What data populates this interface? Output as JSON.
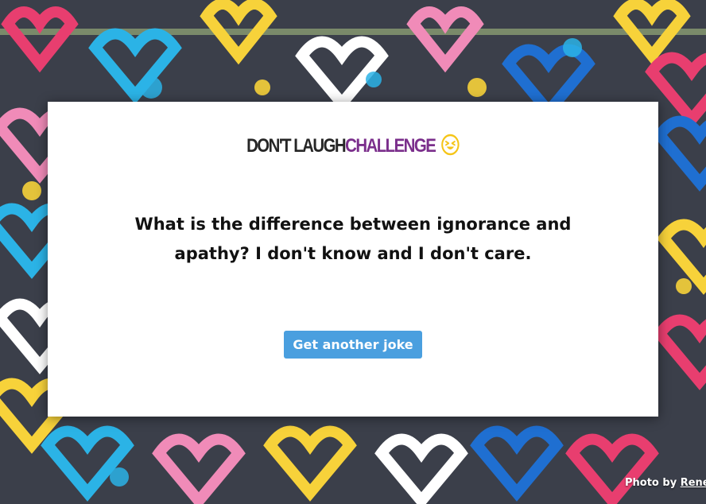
{
  "logo": {
    "part1": "DON'T LAUGH",
    "part2": "CHALLENGE",
    "emoji": "laughing-squinting-face-icon"
  },
  "joke": {
    "text": "What is the difference between ignorance and apathy? I don't know and I don't care."
  },
  "button": {
    "label": "Get another joke"
  },
  "credit": {
    "prefix": "Photo by",
    "author": "Rene"
  },
  "colors": {
    "button": "#4a9fdf",
    "challenge_text": "#7b2f8c",
    "emoji": "#f5c518"
  }
}
